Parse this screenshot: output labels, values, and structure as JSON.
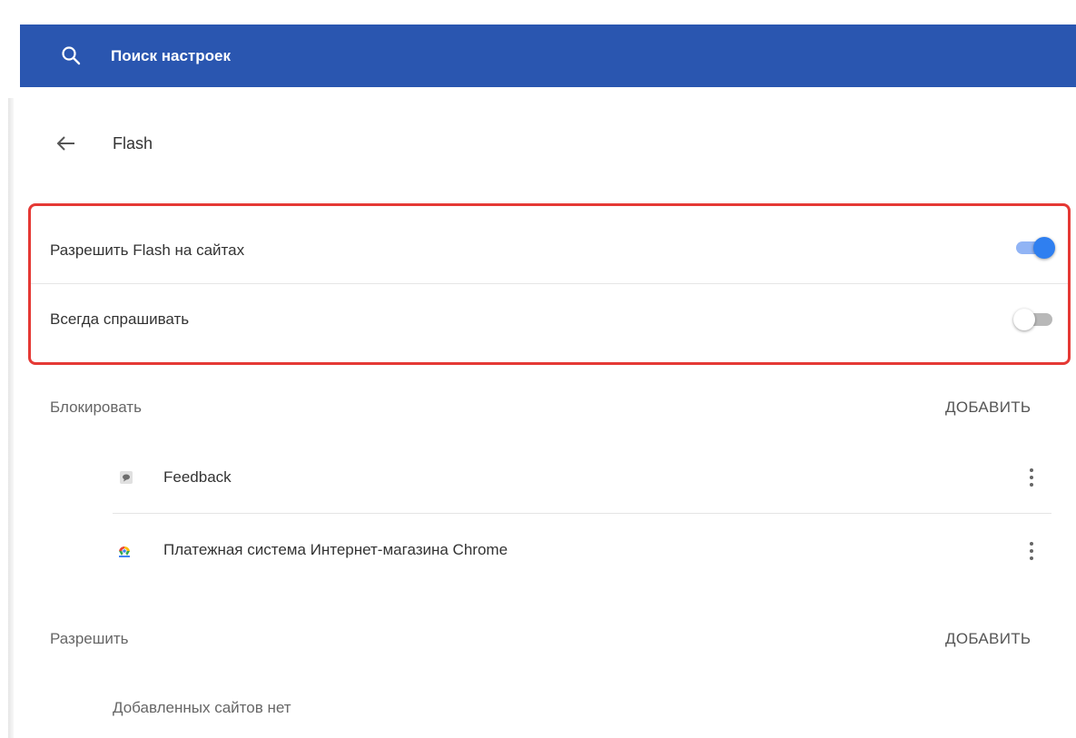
{
  "search": {
    "placeholder": "Поиск настроек",
    "icon": "search-icon"
  },
  "header": {
    "title": "Flash",
    "back_icon": "arrow-left-icon"
  },
  "flash_settings": {
    "allow": {
      "label": "Разрешить Flash на сайтах",
      "enabled": true
    },
    "ask": {
      "label": "Всегда спрашивать",
      "enabled": false
    }
  },
  "block_section": {
    "title": "Блокировать",
    "add_label": "ДОБАВИТЬ",
    "sites": [
      {
        "name": "Feedback",
        "icon": "feedback-icon"
      },
      {
        "name": "Платежная система Интернет-магазина Chrome",
        "icon": "chrome-webstore-icon"
      }
    ]
  },
  "allow_section": {
    "title": "Разрешить",
    "add_label": "ДОБАВИТЬ",
    "empty_text": "Добавленных сайтов нет"
  },
  "colors": {
    "search_bar": "#2a56b0",
    "toggle_on": "#2f7ff0",
    "highlight": "#e53935"
  }
}
